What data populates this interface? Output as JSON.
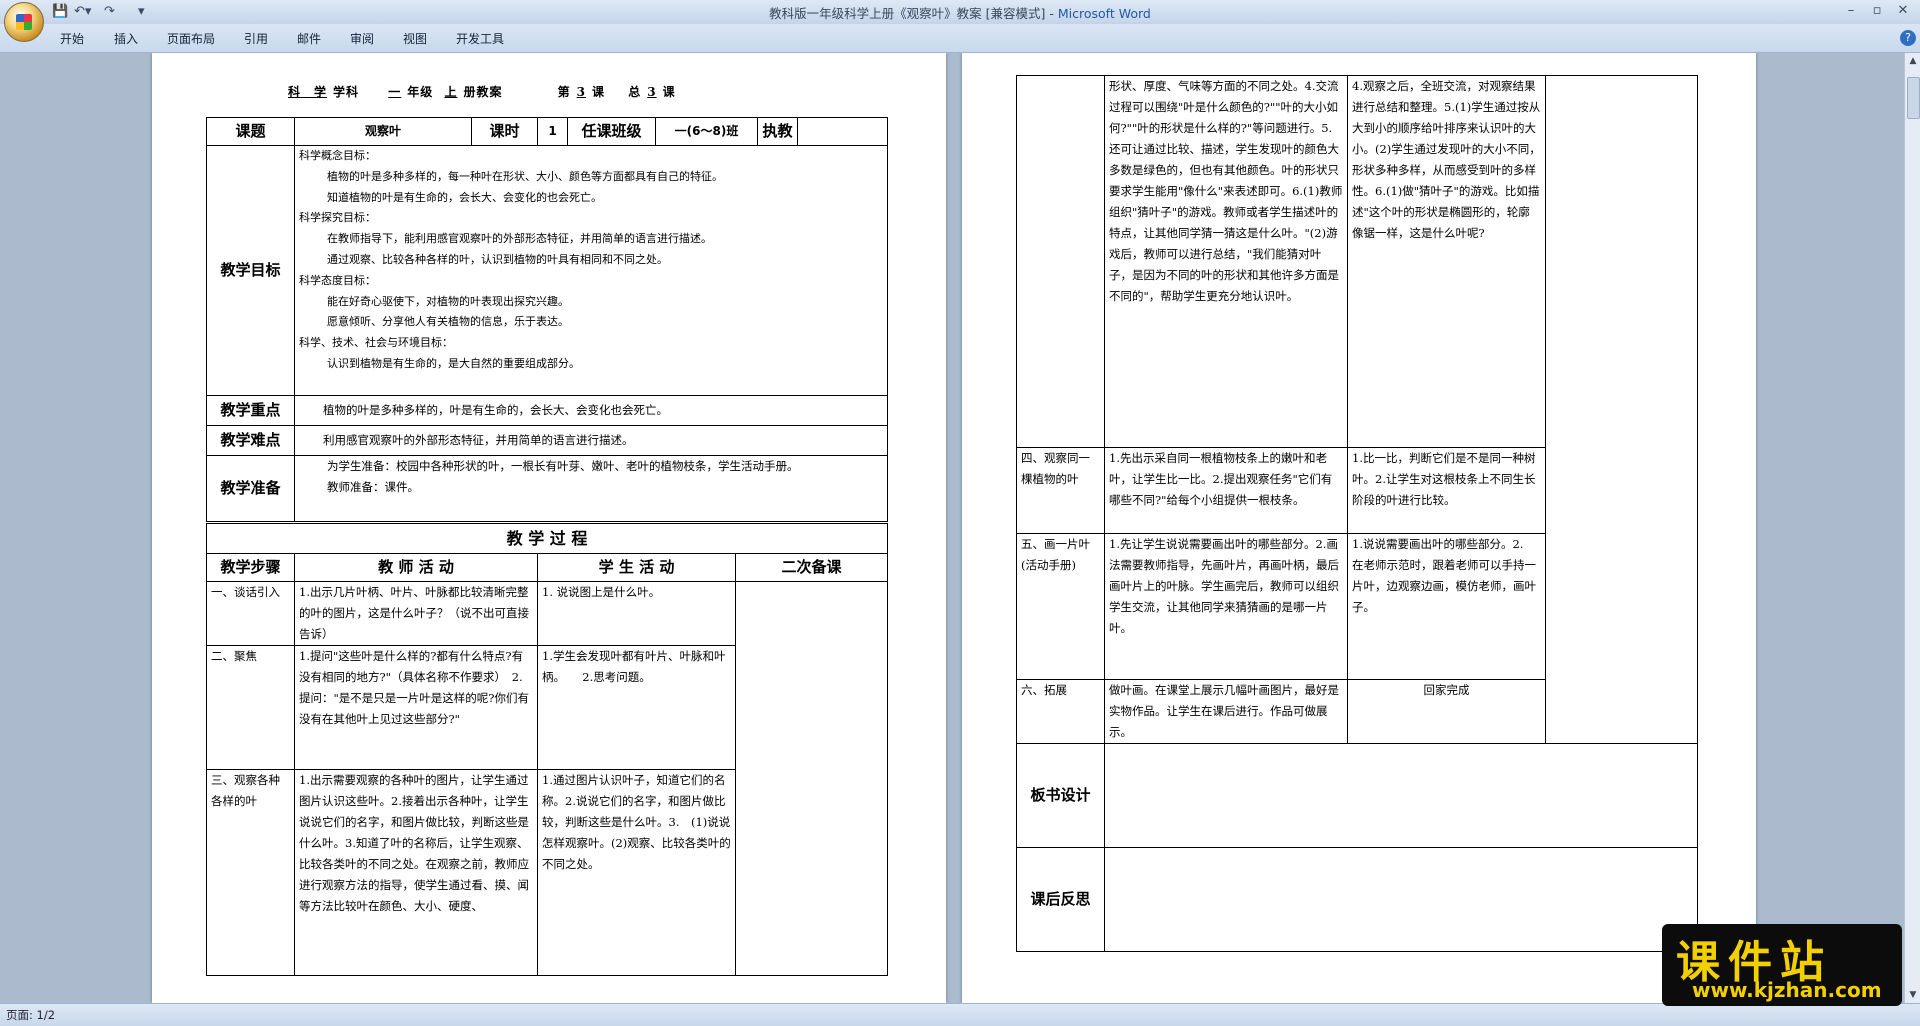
{
  "window": {
    "title": "教科版一年级科学上册《观察叶》教案 [兼容模式] - ",
    "app": "Microsoft Word"
  },
  "ribbon": {
    "tabs": [
      "开始",
      "插入",
      "页面布局",
      "引用",
      "邮件",
      "审阅",
      "视图",
      "开发工具"
    ]
  },
  "status": {
    "page": "页面: 1/2"
  },
  "watermark": {
    "text": "课件站",
    "url": "www.kjzhan.com"
  },
  "doc": {
    "header": {
      "subject": "科　学",
      "subject_label": "学科",
      "grade": "一",
      "grade_label": "年级",
      "term": "上",
      "term_label": "册教案",
      "lesson_no": "3",
      "lesson_label": "课",
      "total_no": "3",
      "total_prefix": "第",
      "total_prefix2": "总",
      "total_label": "课"
    },
    "info": {
      "topic_label": "课题",
      "topic": "观察叶",
      "hours_label": "课时",
      "hours": "1",
      "class_label": "任课班级",
      "class": "一(6～8)班",
      "teacher_label": "执教"
    },
    "goals_label": "教学目标",
    "goals": [
      "科学概念目标：",
      "植物的叶是多种多样的，每一种叶在形状、大小、颜色等方面都具有自己的特征。",
      "知道植物的叶是有生命的，会长大、会变化的也会死亡。",
      "科学探究目标：",
      "在教师指导下，能利用感官观察叶的外部形态特征，并用简单的语言进行描述。",
      "通过观察、比较各种各样的叶，认识到植物的叶具有相同和不同之处。",
      "科学态度目标：",
      "能在好奇心驱使下，对植物的叶表现出探究兴趣。",
      "愿意倾听、分享他人有关植物的信息，乐于表达。",
      "科学、技术、社会与环境目标：",
      "认识到植物是有生命的，是大自然的重要组成部分。"
    ],
    "key_label": "教学重点",
    "key": "植物的叶是多种多样的，叶是有生命的，会长大、会变化也会死亡。",
    "diff_label": "教学难点",
    "diff": "利用感官观察叶的外部形态特征，并用简单的语言进行描述。",
    "prep_label": "教学准备",
    "prep": [
      "为学生准备：校园中各种形状的叶，一根长有叶芽、嫩叶、老叶的植物枝条，学生活动手册。",
      "教师准备：课件。"
    ],
    "process_title": "教 学 过 程",
    "cols": {
      "step": "教学步骤",
      "teacher": "教 师 活 动",
      "student": "学 生 活 动",
      "note": "二次备课"
    },
    "p1rows": [
      {
        "step": "一、谈话引入",
        "teacher": "1.出示几片叶柄、叶片、叶脉都比较清晰完整的叶的图片，这是什么叶子？（说不出可直接告诉）",
        "student": "1. 说说图上是什么叶。"
      },
      {
        "step": "二、聚焦",
        "teacher": "1.提问\"这些叶是什么样的?都有什么特点?有没有相同的地方?\"（具体名称不作要求）　2.提问：\"是不是只是一片叶是这样的呢?你们有没有在其他叶上见过这些部分?\"",
        "student": "1.学生会发现叶都有叶片、叶脉和叶柄。　　2.思考问题。"
      },
      {
        "step": "三、观察各种各样的叶",
        "teacher": "1.出示需要观察的各种叶的图片，让学生通过图片认识这些叶。2.接着出示各种叶，让学生说说它们的名字，和图片做比较，判断这些是什么叶。3.知道了叶的名称后，让学生观察、比较各类叶的不同之处。在观察之前，教师应进行观察方法的指导，使学生通过看、摸、闻等方法比较叶在颜色、大小、硬度、",
        "student": "1.通过图片认识叶子，知道它们的名称。2.说说它们的名字，和图片做比较，判断这些是什么叶。3.　(1)说说怎样观察叶。(2)观察、比较各类叶的不同之处。"
      }
    ],
    "p2rows": [
      {
        "step": "",
        "teacher": "形状、厚度、气味等方面的不同之处。4.交流过程可以围绕\"叶是什么颜色的?\"\"叶的大小如何?\"\"叶的形状是什么样的?\"等问题进行。5.还可让通过比较、描述，学生发现叶的颜色大多数是绿色的，但也有其他颜色。叶的形状只要求学生能用\"像什么\"来表述即可。6.(1)教师组织\"猜叶子\"的游戏。教师或者学生描述叶的特点，让其他同学猜一猜这是什么叶。\"(2)游戏后，教师可以进行总结，\"我们能猜对叶子，是因为不同的叶的形状和其他许多方面是不同的\"，帮助学生更充分地认识叶。",
        "student": "4.观察之后，全班交流，对观察结果进行总结和整理。5.(1)学生通过按从大到小的顺序给叶排序来认识叶的大小。(2)学生通过发现叶的大小不同，形状多种多样，从而感受到叶的多样性。6.(1)做\"猜叶子\"的游戏。比如描述\"这个叶的形状是椭圆形的，轮廓像锯一样，这是什么叶呢?"
      },
      {
        "step": "四、观察同一棵植物的叶",
        "teacher": "1.先出示采自同一根植物枝条上的嫩叶和老叶，让学生比一比。2.提出观察任务\"它们有哪些不同?\"给每个小组提供一根枝条。",
        "student": "1.比一比，判断它们是不是同一种树叶。2.让学生对这根枝条上不同生长阶段的叶进行比较。"
      },
      {
        "step": "五、画一片叶(活动手册)",
        "teacher": "1.先让学生说说需要画出叶的哪些部分。2.画法需要教师指导，先画叶片，再画叶柄，最后画叶片上的叶脉。学生画完后，教师可以组织学生交流，让其他同学来猜猜画的是哪一片叶。",
        "student": "1.说说需要画出叶的哪些部分。2.　在老师示范时，跟着老师可以手持一片叶，边观察边画，模仿老师，画叶子。"
      },
      {
        "step": "六、拓展",
        "teacher": "做叶画。在课堂上展示几幅叶画图片，最好是实物作品。让学生在课后进行。作品可做展示。",
        "student": "回家完成"
      }
    ],
    "board_label": "板书设计",
    "reflect_label": "课后反思"
  }
}
